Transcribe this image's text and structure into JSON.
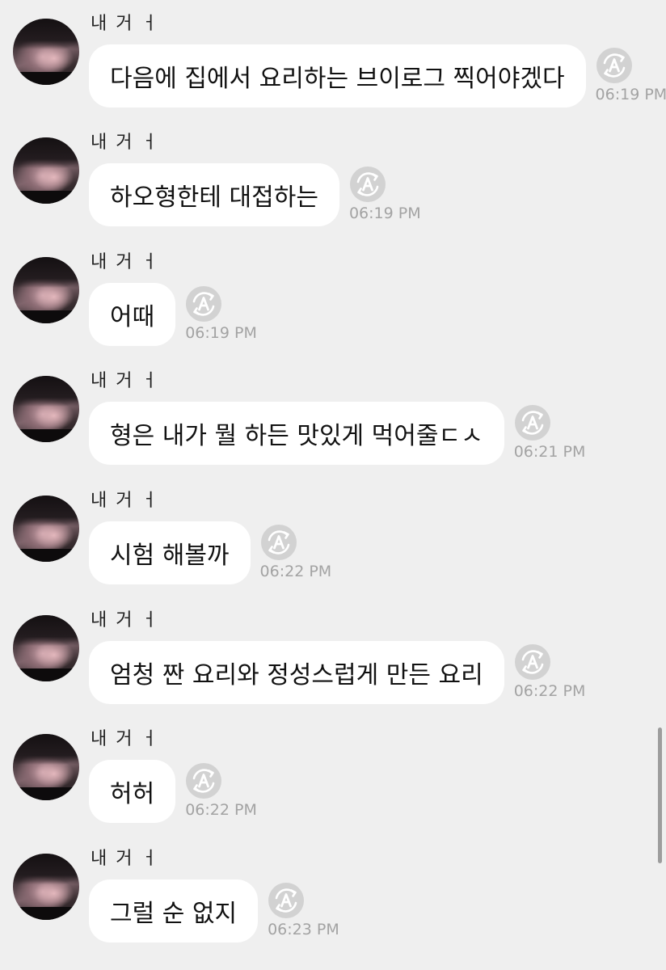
{
  "messages": [
    {
      "sender": "내 거 ㅓ",
      "text": "다음에 집에서 요리하는 브이로그 찍어야겠다",
      "time": "06:19 PM"
    },
    {
      "sender": "내 거 ㅓ",
      "text": "하오형한테 대접하는",
      "time": "06:19 PM"
    },
    {
      "sender": "내 거 ㅓ",
      "text": "어때",
      "time": "06:19 PM"
    },
    {
      "sender": "내 거 ㅓ",
      "text": "형은 내가 뭘 하든 맛있게 먹어줄ㄷㅅ",
      "time": "06:21 PM"
    },
    {
      "sender": "내 거 ㅓ",
      "text": "시험 해볼까",
      "time": "06:22 PM"
    },
    {
      "sender": "내 거 ㅓ",
      "text": "엄청 짠 요리와 정성스럽게 만든 요리",
      "time": "06:22 PM"
    },
    {
      "sender": "내 거 ㅓ",
      "text": "허허",
      "time": "06:22 PM"
    },
    {
      "sender": "내 거 ㅓ",
      "text": "그럴 순 없지",
      "time": "06:23 PM"
    }
  ],
  "icons": {
    "avatar": "profile-photo",
    "translate": "translate-icon"
  },
  "colors": {
    "background": "#efefef",
    "bubble": "#ffffff",
    "text": "#111111",
    "timestamp": "#a3a3a3",
    "icon_circle": "#d2d2d2"
  }
}
